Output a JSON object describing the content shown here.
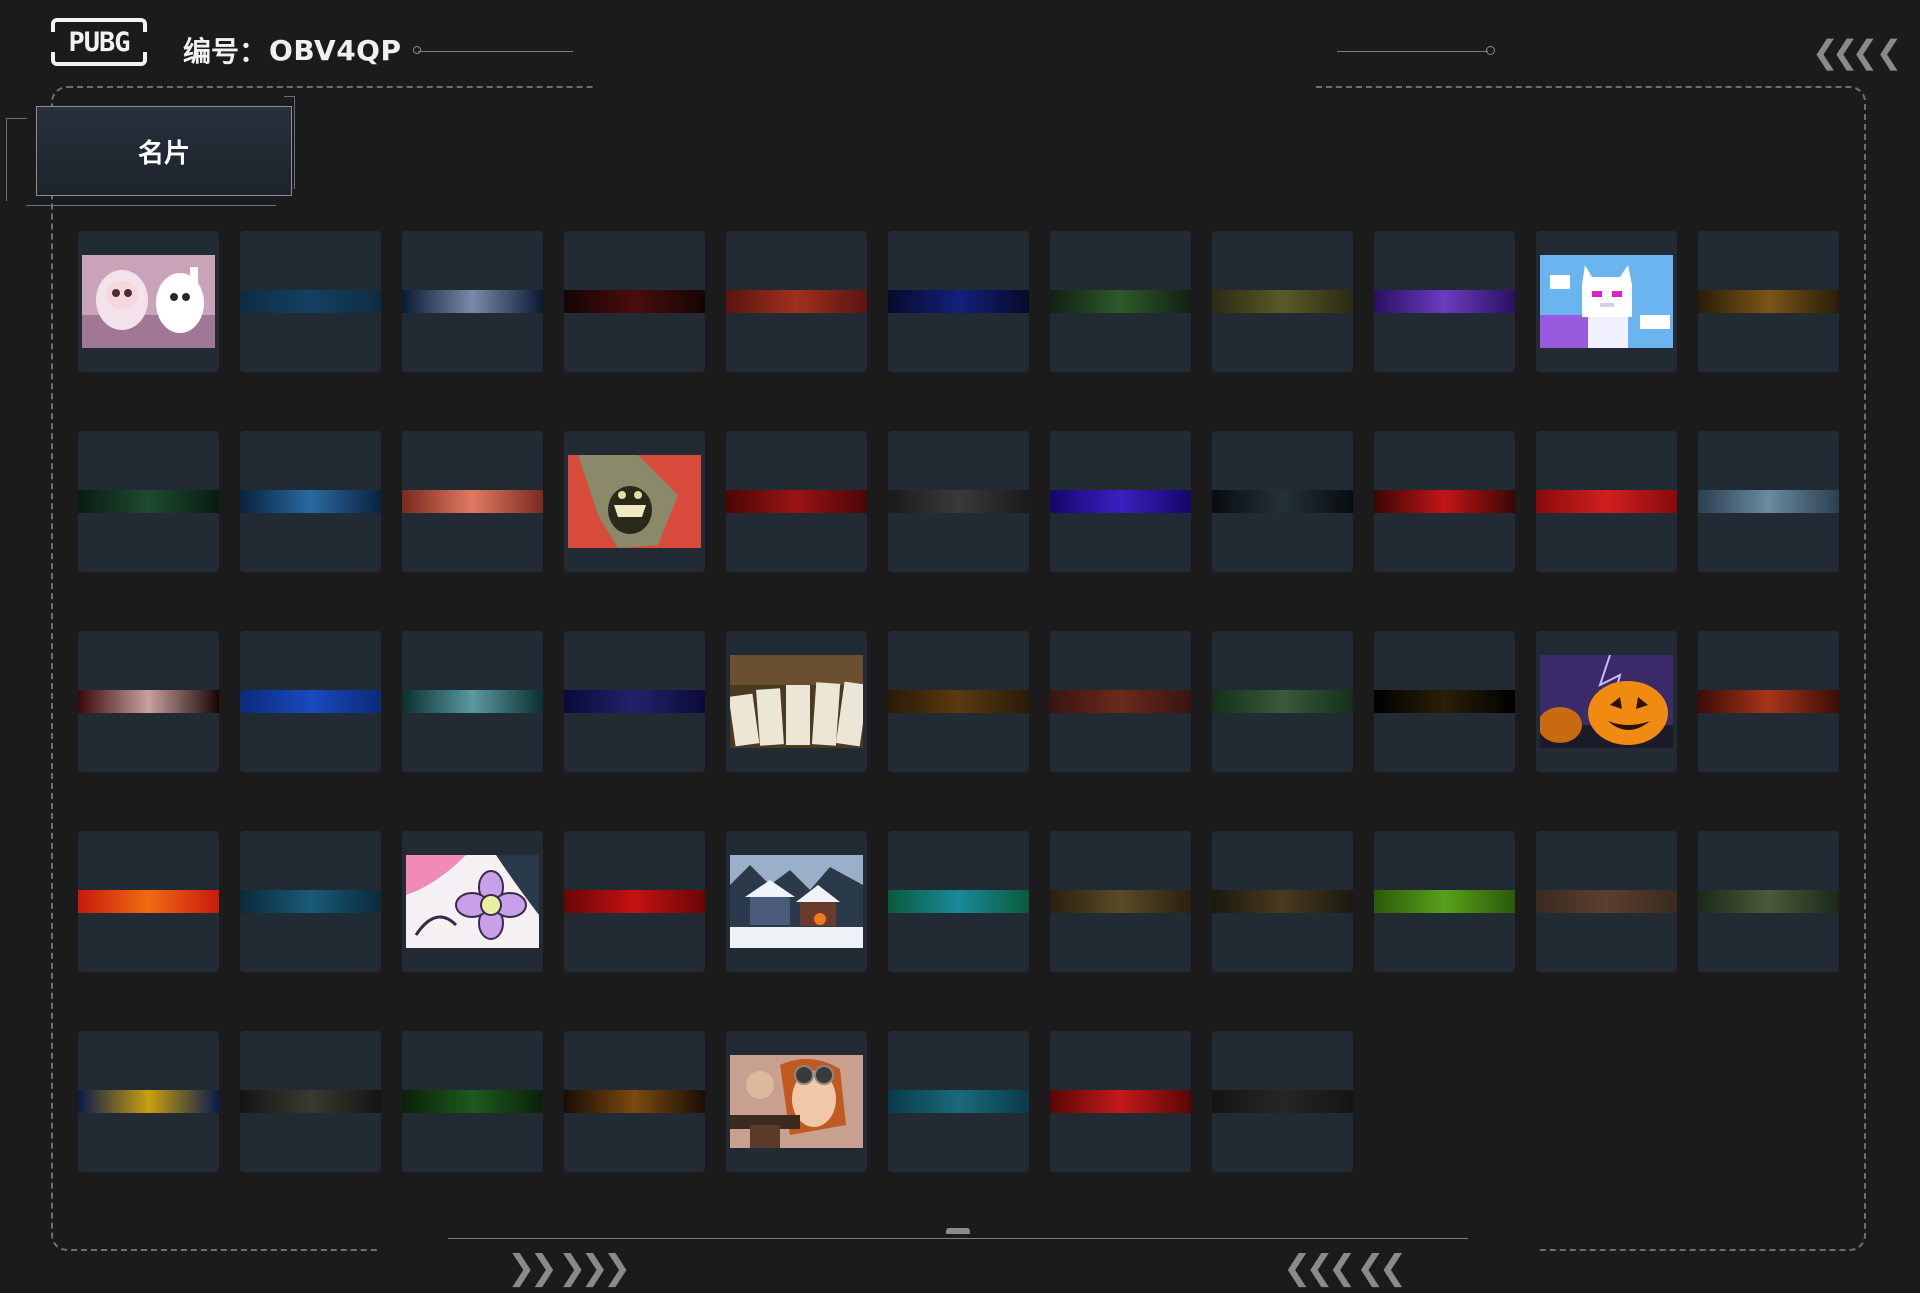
{
  "header": {
    "logo_text": "PUBG",
    "id_label": "编号：",
    "id_value": "OBV4QP"
  },
  "tab": {
    "label": "名片"
  },
  "nav": {
    "top_right_arrows": "❮❮❮ ❮",
    "bottom_left_arrows": "❯❯ ❯❯❯",
    "bottom_right_arrows": "❮❮❮ ❮❮"
  },
  "cards": [
    {
      "type": "image",
      "scene": "cartoon"
    },
    {
      "type": "strip",
      "colors": [
        "#0f2a40",
        "#134163",
        "#0f2a40"
      ]
    },
    {
      "type": "strip",
      "colors": [
        "#0a1a33",
        "#7a8aa8",
        "#0a1a33"
      ]
    },
    {
      "type": "strip",
      "colors": [
        "#140505",
        "#4a0c0c",
        "#140505"
      ]
    },
    {
      "type": "strip",
      "colors": [
        "#5a1410",
        "#a0301e",
        "#5a1410"
      ]
    },
    {
      "type": "strip",
      "colors": [
        "#060a2a",
        "#14207a",
        "#060a2a"
      ]
    },
    {
      "type": "strip",
      "colors": [
        "#102014",
        "#2f5a2a",
        "#102014"
      ]
    },
    {
      "type": "strip",
      "colors": [
        "#2b2a14",
        "#5a5a26",
        "#2b2a14"
      ]
    },
    {
      "type": "strip",
      "colors": [
        "#2a1060",
        "#6a3cc0",
        "#2a1060"
      ]
    },
    {
      "type": "image",
      "scene": "pixelcat"
    },
    {
      "type": "strip",
      "colors": [
        "#2a1c08",
        "#7a5618",
        "#2a1c08"
      ]
    },
    {
      "type": "strip",
      "colors": [
        "#0a1c12",
        "#1e4a30",
        "#0a1c12"
      ]
    },
    {
      "type": "strip",
      "colors": [
        "#0a2240",
        "#2a6aa0",
        "#0a2240"
      ]
    },
    {
      "type": "strip",
      "colors": [
        "#7a2a20",
        "#e07a62",
        "#7a2a20"
      ]
    },
    {
      "type": "image",
      "scene": "monster"
    },
    {
      "type": "strip",
      "colors": [
        "#4a0606",
        "#9a1414",
        "#4a0606"
      ]
    },
    {
      "type": "strip",
      "colors": [
        "#1a1a1a",
        "#3a3a3a",
        "#1a1a1a"
      ]
    },
    {
      "type": "strip",
      "colors": [
        "#14066a",
        "#3a20c0",
        "#14066a"
      ]
    },
    {
      "type": "strip",
      "colors": [
        "#080c10",
        "#243038",
        "#080c10"
      ]
    },
    {
      "type": "strip",
      "colors": [
        "#3a0606",
        "#c01616",
        "#3a0606"
      ]
    },
    {
      "type": "strip",
      "colors": [
        "#8a0a0a",
        "#d02020",
        "#8a0a0a"
      ]
    },
    {
      "type": "strip",
      "colors": [
        "#2a4050",
        "#6a8aa0",
        "#2a4050"
      ]
    },
    {
      "type": "strip",
      "colors": [
        "#3a0808",
        "#c8a0a0",
        "#1a0404"
      ]
    },
    {
      "type": "strip",
      "colors": [
        "#0a2a7a",
        "#1a4ac0",
        "#0a2a7a"
      ]
    },
    {
      "type": "strip",
      "colors": [
        "#0a3030",
        "#5a9aa0",
        "#0a3030"
      ]
    },
    {
      "type": "strip",
      "colors": [
        "#0a0a3a",
        "#22226a",
        "#0a0a3a"
      ]
    },
    {
      "type": "image",
      "scene": "cards"
    },
    {
      "type": "strip",
      "colors": [
        "#2a1a06",
        "#5a3a10",
        "#2a1a06"
      ]
    },
    {
      "type": "strip",
      "colors": [
        "#3a1410",
        "#6a2a1c",
        "#3a1410"
      ]
    },
    {
      "type": "strip",
      "colors": [
        "#14301a",
        "#3a5a3a",
        "#14301a"
      ]
    },
    {
      "type": "strip",
      "colors": [
        "#000000",
        "#2a2008",
        "#000000"
      ]
    },
    {
      "type": "image",
      "scene": "pumpkin"
    },
    {
      "type": "strip",
      "colors": [
        "#3a0c06",
        "#a8341a",
        "#3a0c06"
      ]
    },
    {
      "type": "strip",
      "colors": [
        "#c81a0a",
        "#f06a14",
        "#c81a0a"
      ]
    },
    {
      "type": "strip",
      "colors": [
        "#0a2a3a",
        "#1a5a7a",
        "#0a2a3a"
      ]
    },
    {
      "type": "image",
      "scene": "flower"
    },
    {
      "type": "strip",
      "colors": [
        "#6a0606",
        "#c41212",
        "#6a0606"
      ]
    },
    {
      "type": "image",
      "scene": "snow"
    },
    {
      "type": "strip",
      "colors": [
        "#0a5a3a",
        "#1a8a9a",
        "#0a5a3a"
      ]
    },
    {
      "type": "strip",
      "colors": [
        "#2a2010",
        "#5a4a28",
        "#2a2010"
      ]
    },
    {
      "type": "strip",
      "colors": [
        "#1a1810",
        "#4a3a20",
        "#1a1810"
      ]
    },
    {
      "type": "strip",
      "colors": [
        "#2a5a0a",
        "#5aa01a",
        "#2a5a0a"
      ]
    },
    {
      "type": "strip",
      "colors": [
        "#3a2a20",
        "#5a4030",
        "#3a2a20"
      ]
    },
    {
      "type": "strip",
      "colors": [
        "#1a2a1a",
        "#4a5a3a",
        "#1a2a1a"
      ]
    },
    {
      "type": "strip",
      "colors": [
        "#0a1a4a",
        "#c8a010",
        "#0a1a4a"
      ]
    },
    {
      "type": "strip",
      "colors": [
        "#141414",
        "#3a3a30",
        "#141414"
      ]
    },
    {
      "type": "strip",
      "colors": [
        "#0a200a",
        "#1e5a1e",
        "#0a200a"
      ]
    },
    {
      "type": "strip",
      "colors": [
        "#1a0c04",
        "#7a4a10",
        "#1a0c04"
      ]
    },
    {
      "type": "image",
      "scene": "pilot"
    },
    {
      "type": "strip",
      "colors": [
        "#0a3a4a",
        "#1a6a7a",
        "#0a3a4a"
      ]
    },
    {
      "type": "strip",
      "colors": [
        "#5a0606",
        "#c41a1a",
        "#5a0606"
      ]
    },
    {
      "type": "strip",
      "colors": [
        "#141414",
        "#262626",
        "#141414"
      ]
    }
  ]
}
